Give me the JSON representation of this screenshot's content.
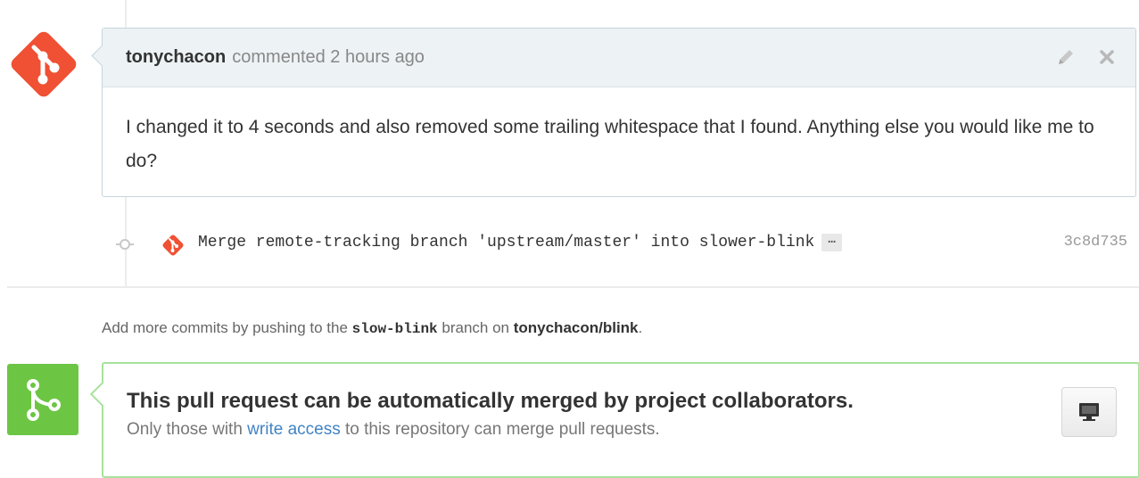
{
  "comment": {
    "author": "tonychacon",
    "meta": "commented 2 hours ago",
    "body": "I changed it to 4 seconds and also removed some trailing whitespace that I found. Anything else you would like me to do?",
    "edit_icon": "pencil-icon",
    "close_icon": "close-icon"
  },
  "commit": {
    "message": "Merge remote-tracking branch 'upstream/master' into slower-blink",
    "ellipsis": "…",
    "sha": "3c8d735"
  },
  "push_hint": {
    "prefix": "Add more commits by pushing to the ",
    "branch": "slow-blink",
    "middle": " branch on ",
    "repo": "tonychacon/blink",
    "suffix": "."
  },
  "merge": {
    "title": "This pull request can be automatically merged by project collaborators.",
    "sub_prefix": "Only those with ",
    "link": "write access",
    "sub_suffix": " to this repository can merge pull requests."
  },
  "colors": {
    "git_orange": "#f05033",
    "merge_green": "#6cc644",
    "link_blue": "#4183c4"
  }
}
